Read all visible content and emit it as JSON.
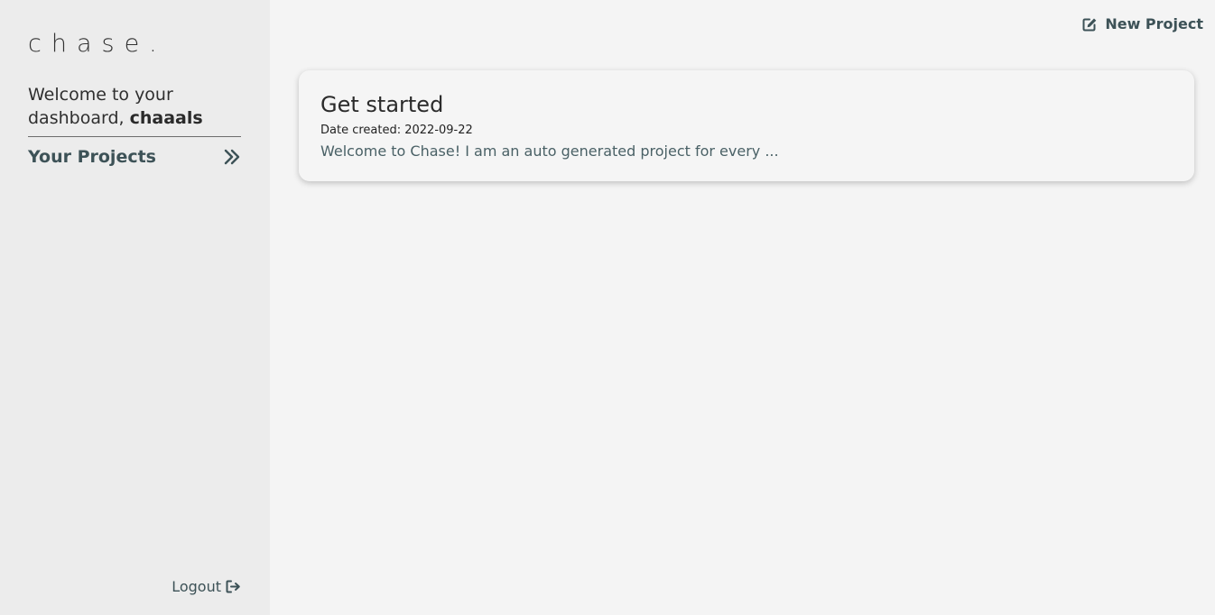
{
  "sidebar": {
    "logo": "chase.",
    "welcome_prefix": "Welcome to your dashboard, ",
    "username": "chaaals",
    "nav_label": "Your Projects",
    "nav_icon": "double-chevron-right-icon",
    "logout_label": "Logout",
    "logout_icon": "sign-out-icon"
  },
  "header": {
    "new_project_label": "New Project",
    "new_project_icon": "edit-icon"
  },
  "projects": [
    {
      "title": "Get started",
      "date_label": "Date created: ",
      "date": "2022-09-22",
      "description": "Welcome to Chase! I am an auto generated project for every ..."
    }
  ],
  "colors": {
    "sidebar_bg": "#ececec",
    "main_bg": "#f4f4f4",
    "accent": "#3d5257"
  }
}
